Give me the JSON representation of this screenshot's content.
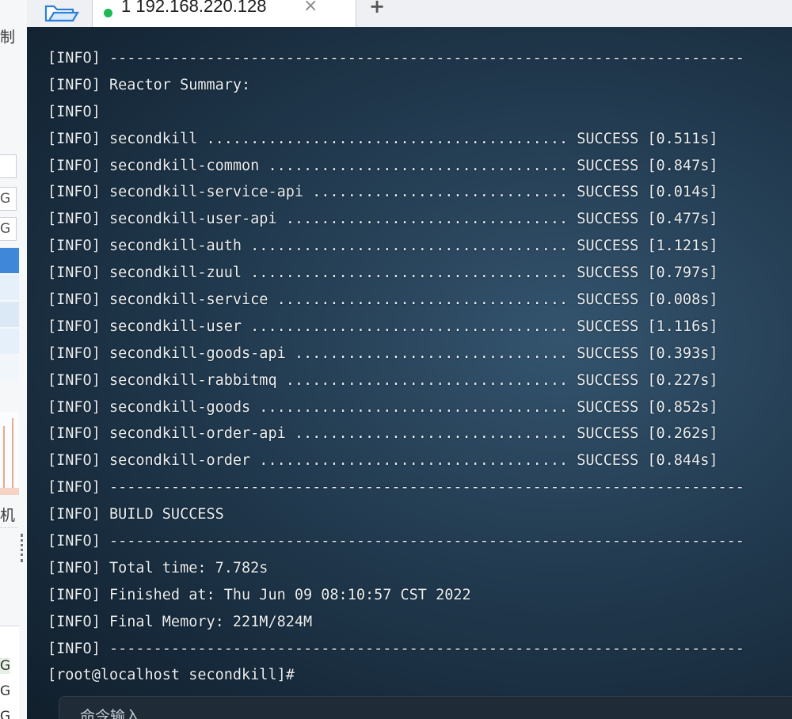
{
  "left_panel": {
    "top_char": "制",
    "box_values": [
      "G",
      "G"
    ],
    "label_char": "机",
    "bottom_values": [
      "G",
      "G",
      "G"
    ]
  },
  "tabs": [
    {
      "label": "1 192.168.220.128",
      "close_glyph": "×",
      "status": "connected"
    }
  ],
  "add_tab_glyph": "+",
  "colors": {
    "status_dot": "#1fb954",
    "terminal_bg": "#1d3447",
    "terminal_text": "#e9eef2",
    "selection_blue": "#3f87d8"
  },
  "terminal": {
    "lines": [
      "[INFO] ------------------------------------------------------------------------",
      "[INFO] Reactor Summary:",
      "[INFO]",
      "[INFO] secondkill ......................................... SUCCESS [0.511s]",
      "[INFO] secondkill-common .................................. SUCCESS [0.847s]",
      "[INFO] secondkill-service-api ............................. SUCCESS [0.014s]",
      "[INFO] secondkill-user-api ................................ SUCCESS [0.477s]",
      "[INFO] secondkill-auth .................................... SUCCESS [1.121s]",
      "[INFO] secondkill-zuul .................................... SUCCESS [0.797s]",
      "[INFO] secondkill-service ................................. SUCCESS [0.008s]",
      "[INFO] secondkill-user .................................... SUCCESS [1.116s]",
      "[INFO] secondkill-goods-api ............................... SUCCESS [0.393s]",
      "[INFO] secondkill-rabbitmq ................................ SUCCESS [0.227s]",
      "[INFO] secondkill-goods ................................... SUCCESS [0.852s]",
      "[INFO] secondkill-order-api ............................... SUCCESS [0.262s]",
      "[INFO] secondkill-order ................................... SUCCESS [0.844s]",
      "[INFO] ------------------------------------------------------------------------",
      "[INFO] BUILD SUCCESS",
      "[INFO] ------------------------------------------------------------------------",
      "[INFO] Total time: 7.782s",
      "[INFO] Finished at: Thu Jun 09 08:10:57 CST 2022",
      "[INFO] Final Memory: 221M/824M",
      "[INFO] ------------------------------------------------------------------------",
      "[root@localhost secondkill]#"
    ]
  },
  "command_input": {
    "placeholder": "命令输入"
  }
}
